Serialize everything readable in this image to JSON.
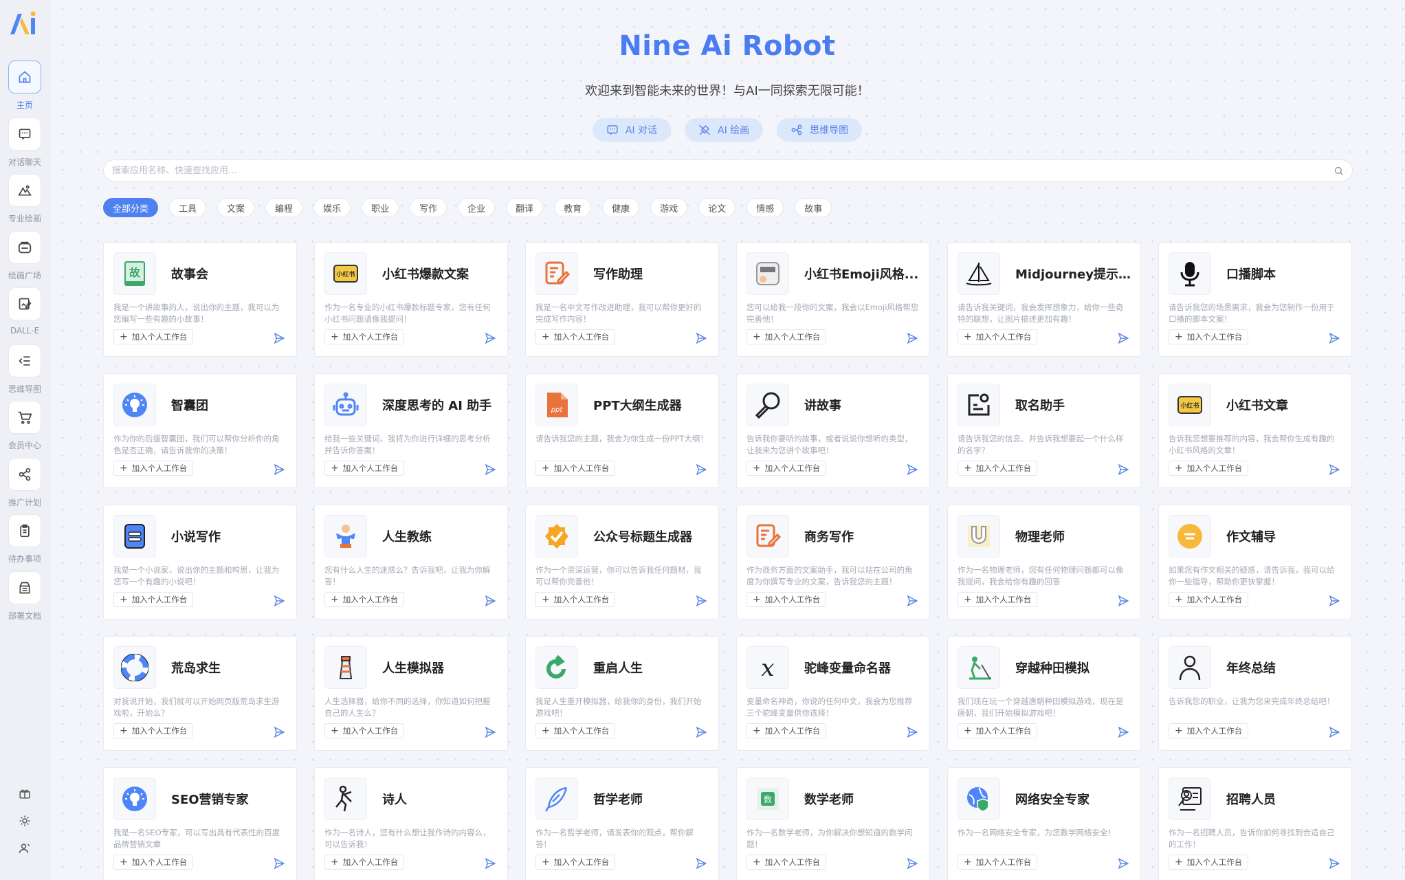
{
  "app": {
    "title": "Nine Ai Robot",
    "subtitle": "欢迎来到智能未来的世界！与AI一同探索无限可能！"
  },
  "modes": [
    {
      "label": "AI 对话",
      "icon": "chat-icon"
    },
    {
      "label": "AI 绘画",
      "icon": "paint-icon"
    },
    {
      "label": "思维导图",
      "icon": "mindmap-icon"
    }
  ],
  "sidebar": {
    "items": [
      {
        "label": "主页",
        "icon": "home-icon",
        "active": true
      },
      {
        "label": "对话聊天",
        "icon": "chat-icon"
      },
      {
        "label": "专业绘画",
        "icon": "mountain-icon"
      },
      {
        "label": "绘画广场",
        "icon": "gallery-icon"
      },
      {
        "label": "DALL-E",
        "icon": "edit-image-icon"
      },
      {
        "label": "思维导图",
        "icon": "list-indent-icon"
      },
      {
        "label": "会员中心",
        "icon": "cart-icon"
      },
      {
        "label": "推广计划",
        "icon": "share-icon"
      },
      {
        "label": "待办事项",
        "icon": "clipboard-icon"
      },
      {
        "label": "部署文档",
        "icon": "archive-icon"
      }
    ],
    "bottom": [
      "gift-icon",
      "sun-icon",
      "user-icon"
    ]
  },
  "search": {
    "placeholder": "搜索应用名称、快速查找应用..."
  },
  "categories": [
    "全部分类",
    "工具",
    "文案",
    "编程",
    "娱乐",
    "职业",
    "写作",
    "企业",
    "翻译",
    "教育",
    "健康",
    "游戏",
    "论文",
    "情感",
    "故事"
  ],
  "add_label": "加入个人工作台",
  "cards": [
    {
      "title": "故事会",
      "desc": "我是一个讲故事的人，说出你的主题，我可以为您编写一些有趣的小故事！",
      "icon": "story-book-icon"
    },
    {
      "title": "小红书爆款文案",
      "desc": "作为一名专业的小红书爆款标题专家，您有任何小红书问题请像我提问！",
      "icon": "xiaohongshu-icon"
    },
    {
      "title": "写作助理",
      "desc": "我是一名中文写作改进助理，我可以帮你更好的完成写作内容！",
      "icon": "writing-icon"
    },
    {
      "title": "小红书Emoji风格...",
      "desc": "您可以给我一段你的文案，我会以Emoji风格帮您完善他！",
      "icon": "emoji-note-icon"
    },
    {
      "title": "Midjourney提示...",
      "desc": "请告诉我关键词，我会发挥想象力，给你一些奇特的联想，让图片描述更加有趣！",
      "icon": "sailboat-icon"
    },
    {
      "title": "口播脚本",
      "desc": "请告诉我您的场景需求，我会为您制作一份用于口播的脚本文案！",
      "icon": "microphone-icon"
    },
    {
      "title": "智囊团",
      "desc": "作为你的后援智囊团，我们可以帮你分析你的角色是否正确，请告诉我你的决策！",
      "icon": "lightbulb-icon"
    },
    {
      "title": "深度思考的 AI 助手",
      "desc": "给我一些关键词，我将为你进行详细的思考分析并告诉你答案！",
      "icon": "robot-icon"
    },
    {
      "title": "PPT大纲生成器",
      "desc": "请告诉我您的主题，我会为你生成一份PPT大纲！",
      "icon": "ppt-icon"
    },
    {
      "title": "讲故事",
      "desc": "告诉我你要听的故事，或者说说你想听的类型，让我来为您讲个故事吧！",
      "icon": "magnifier-icon"
    },
    {
      "title": "取名助手",
      "desc": "请告诉我您的信息、并告诉我想要起一个什么样的名字？",
      "icon": "name-card-icon"
    },
    {
      "title": "小红书文章",
      "desc": "告诉我您想要推荐的内容，我会帮你生成有趣的小红书风格的文章！",
      "icon": "xiaohongshu-icon"
    },
    {
      "title": "小说写作",
      "desc": "我是一个小说家，说出你的主题和构思，让我为您写一个有趣的小说吧！",
      "icon": "notebook-icon"
    },
    {
      "title": "人生教练",
      "desc": "您有什么人生的迷惑么？告诉我吧，让我为你解答！",
      "icon": "coach-icon"
    },
    {
      "title": "公众号标题生成器",
      "desc": "作为一个资深运营，你可以告诉我任何题材，我可以帮你完善他！",
      "icon": "badge-check-icon"
    },
    {
      "title": "商务写作",
      "desc": "作为商务方面的文案助手，我可以站在公司的角度为你撰写专业的文案，告诉我您的主题！",
      "icon": "writing-icon"
    },
    {
      "title": "物理老师",
      "desc": "作为一名物理老师，您有任何物理问题都可以像我提问，我会给你有趣的回答",
      "icon": "magnet-icon"
    },
    {
      "title": "作文辅导",
      "desc": "如果您有作文相关的疑惑，请告诉我，我可以给你一些指导，帮助你更快掌握！",
      "icon": "chat-bubble-icon"
    },
    {
      "title": "荒岛求生",
      "desc": "对我说开始，我们就可以开始网页版荒岛求生游戏啦，开始么？",
      "icon": "lifebuoy-icon"
    },
    {
      "title": "人生模拟器",
      "desc": "人生选择器，给你不同的选择，你知道如何把握自己的人生么？",
      "icon": "lighthouse-icon"
    },
    {
      "title": "重启人生",
      "desc": "我是人生重开模拟器，给我你的身份，我们开始游戏吧！",
      "icon": "restart-icon"
    },
    {
      "title": "驼峰变量命名器",
      "desc": "变量命名神奇，你说的任何中文，我会为您推荐三个驼峰变量供你选择！",
      "icon": "variable-icon"
    },
    {
      "title": "穿越种田模拟",
      "desc": "我们现在玩一个穿越唐朝种田模拟游戏，现在是唐朝，我们开始模拟游戏吧！",
      "icon": "farmer-icon"
    },
    {
      "title": "年终总结",
      "desc": "告诉我您的职业，让我为您来完成年终总结吧！",
      "icon": "person-icon"
    },
    {
      "title": "SEO营销专家",
      "desc": "我是一名SEO专家，可以写出具有代表性的百度品牌营销文章",
      "icon": "lightbulb-icon"
    },
    {
      "title": "诗人",
      "desc": "作为一名诗人，您有什么想让我作诗的内容么，可以告诉我！",
      "icon": "dancer-icon"
    },
    {
      "title": "哲学老师",
      "desc": "作为一名哲学老师，请发表你的观点，帮你解答！",
      "icon": "feather-icon"
    },
    {
      "title": "数学老师",
      "desc": "作为一名数学老师，为你解决你想知道的数学问题！",
      "icon": "math-icon"
    },
    {
      "title": "网络安全专家",
      "desc": "作为一名网络安全专家，为您教学网络安全！",
      "icon": "globe-shield-icon"
    },
    {
      "title": "招聘人员",
      "desc": "作为一名招聘人员，告诉你如何寻找到合适自己的工作！",
      "icon": "recruiter-icon"
    }
  ],
  "colors": {
    "accent": "#4a7cf2",
    "mode_bg": "#dbe7fb"
  }
}
